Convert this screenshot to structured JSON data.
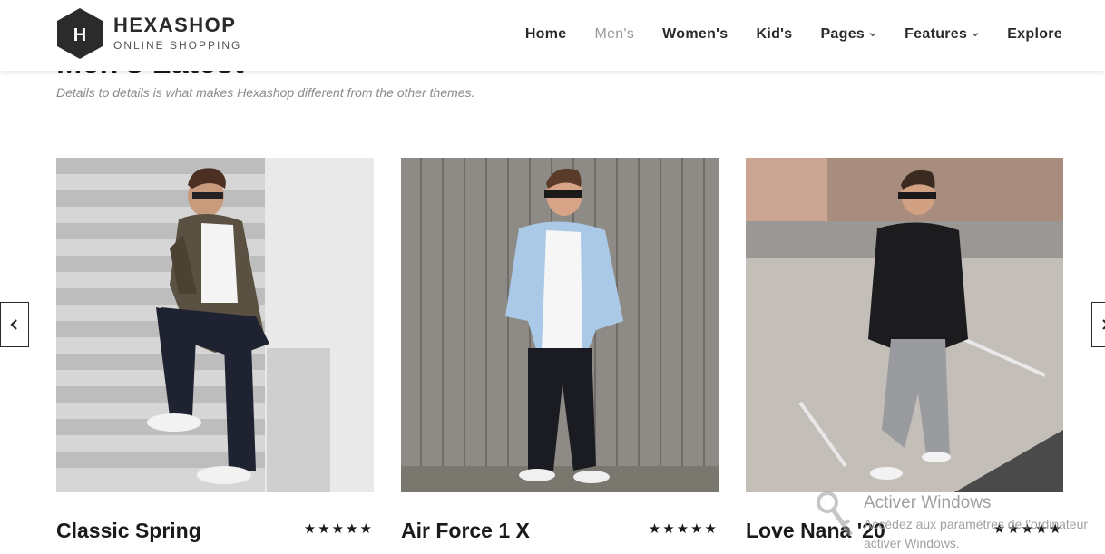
{
  "brand": {
    "name": "HEXASHOP",
    "tagline": "ONLINE SHOPPING",
    "logo_letter": "H"
  },
  "nav": {
    "items": [
      {
        "label": "Home",
        "active": false,
        "dropdown": false
      },
      {
        "label": "Men's",
        "active": true,
        "dropdown": false
      },
      {
        "label": "Women's",
        "active": false,
        "dropdown": false
      },
      {
        "label": "Kid's",
        "active": false,
        "dropdown": false
      },
      {
        "label": "Pages",
        "active": false,
        "dropdown": true
      },
      {
        "label": "Features",
        "active": false,
        "dropdown": true
      },
      {
        "label": "Explore",
        "active": false,
        "dropdown": false
      }
    ]
  },
  "section": {
    "title": "Men's Latest",
    "subtitle": "Details to details is what makes Hexashop different from the other themes."
  },
  "products": [
    {
      "name": "Classic Spring",
      "stars": "★★★★★"
    },
    {
      "name": "Air Force 1 X",
      "stars": "★★★★★"
    },
    {
      "name": "Love Nana '20",
      "stars": "★★★★★"
    }
  ],
  "carousel": {
    "prev_icon": "chevron-left-icon",
    "next_icon": "chevron-right-icon"
  },
  "watermark": {
    "title": "Activer Windows",
    "line1": "Accédez aux paramètres de l'ordinateur",
    "line2": "activer Windows."
  },
  "colors": {
    "dark": "#2a2a2a",
    "muted": "#9a9a9a",
    "logo_bg": "#2b2b2b"
  }
}
